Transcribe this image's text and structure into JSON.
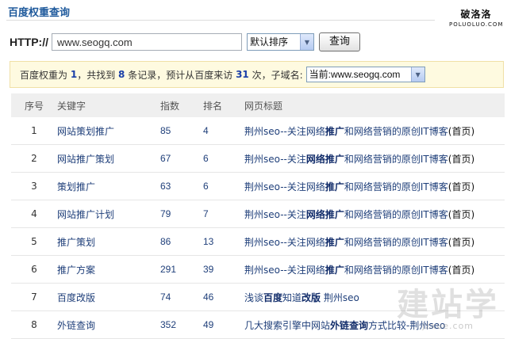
{
  "header": {
    "title": "百度权重查询",
    "logo_cn": "破洛洛",
    "logo_en": "POLUOLUO.COM"
  },
  "query": {
    "label": "HTTP://",
    "input_value": "www.seogq.com",
    "sort_selected": "默认排序",
    "submit_label": "查询"
  },
  "summary": {
    "weight_prefix": "百度权重为",
    "weight": "1",
    "found_prefix": "，共找到",
    "record_count": "8",
    "found_suffix": "条记录，预计从百度来访",
    "visits": "31",
    "visits_suffix": "次，子域名:",
    "subdomain_selected": "当前:www.seogq.com"
  },
  "table": {
    "headers": [
      "序号",
      "关键字",
      "指数",
      "排名",
      "网页标题"
    ],
    "rows": [
      {
        "index": "1",
        "keyword": "网站策划推广",
        "score": "85",
        "rank": "4",
        "title_before": "荆州seo--关注网络",
        "title_bold": "推广",
        "title_after": "和网络营销的原创IT博客",
        "home": "(首页)"
      },
      {
        "index": "2",
        "keyword": "网站推广策划",
        "score": "67",
        "rank": "6",
        "title_before": "荆州seo--关注",
        "title_bold": "网络推广",
        "title_after": "和网络营销的原创IT博客",
        "home": "(首页)"
      },
      {
        "index": "3",
        "keyword": "策划推广",
        "score": "63",
        "rank": "6",
        "title_before": "荆州seo--关注网络",
        "title_bold": "推广",
        "title_after": "和网络营销的原创IT博客",
        "home": "(首页)"
      },
      {
        "index": "4",
        "keyword": "网站推广计划",
        "score": "79",
        "rank": "7",
        "title_before": "荆州seo--关注",
        "title_bold": "网络推广",
        "title_after": "和网络营销的原创IT博客",
        "home": "(首页)"
      },
      {
        "index": "5",
        "keyword": "推广策划",
        "score": "86",
        "rank": "13",
        "title_before": "荆州seo--关注网络",
        "title_bold": "推广",
        "title_after": "和网络营销的原创IT博客",
        "home": "(首页)"
      },
      {
        "index": "6",
        "keyword": "推广方案",
        "score": "291",
        "rank": "39",
        "title_before": "荆州seo--关注网络",
        "title_bold": "推广",
        "title_after": "和网络营销的原创IT博客",
        "home": "(首页)"
      },
      {
        "index": "7",
        "keyword": "百度改版",
        "score": "74",
        "rank": "46",
        "title_before": "浅谈",
        "title_bold": "百度",
        "title_mid": "知道",
        "title_bold2": "改版",
        "title_after": " 荆州seo",
        "home": ""
      },
      {
        "index": "8",
        "keyword": "外链查询",
        "score": "352",
        "rank": "49",
        "title_before": "几大搜索引擎中网站",
        "title_bold": "外链查询",
        "title_after": "方式比较-荆州seo",
        "home": ""
      }
    ]
  },
  "watermark": {
    "cn": "建站学",
    "en": "jzxue.com"
  }
}
